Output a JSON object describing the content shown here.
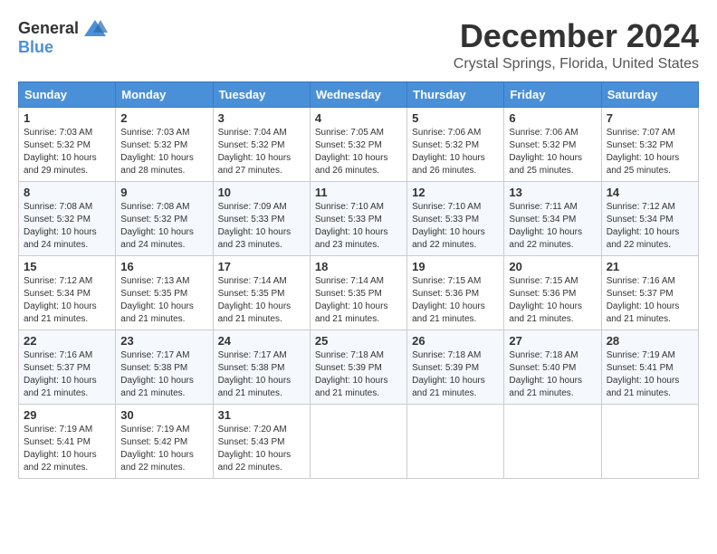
{
  "header": {
    "logo_general": "General",
    "logo_blue": "Blue",
    "month_title": "December 2024",
    "location": "Crystal Springs, Florida, United States"
  },
  "calendar": {
    "days_of_week": [
      "Sunday",
      "Monday",
      "Tuesday",
      "Wednesday",
      "Thursday",
      "Friday",
      "Saturday"
    ],
    "weeks": [
      [
        {
          "day": "1",
          "sunrise": "7:03 AM",
          "sunset": "5:32 PM",
          "daylight": "10 hours and 29 minutes."
        },
        {
          "day": "2",
          "sunrise": "7:03 AM",
          "sunset": "5:32 PM",
          "daylight": "10 hours and 28 minutes."
        },
        {
          "day": "3",
          "sunrise": "7:04 AM",
          "sunset": "5:32 PM",
          "daylight": "10 hours and 27 minutes."
        },
        {
          "day": "4",
          "sunrise": "7:05 AM",
          "sunset": "5:32 PM",
          "daylight": "10 hours and 26 minutes."
        },
        {
          "day": "5",
          "sunrise": "7:06 AM",
          "sunset": "5:32 PM",
          "daylight": "10 hours and 26 minutes."
        },
        {
          "day": "6",
          "sunrise": "7:06 AM",
          "sunset": "5:32 PM",
          "daylight": "10 hours and 25 minutes."
        },
        {
          "day": "7",
          "sunrise": "7:07 AM",
          "sunset": "5:32 PM",
          "daylight": "10 hours and 25 minutes."
        }
      ],
      [
        {
          "day": "8",
          "sunrise": "7:08 AM",
          "sunset": "5:32 PM",
          "daylight": "10 hours and 24 minutes."
        },
        {
          "day": "9",
          "sunrise": "7:08 AM",
          "sunset": "5:32 PM",
          "daylight": "10 hours and 24 minutes."
        },
        {
          "day": "10",
          "sunrise": "7:09 AM",
          "sunset": "5:33 PM",
          "daylight": "10 hours and 23 minutes."
        },
        {
          "day": "11",
          "sunrise": "7:10 AM",
          "sunset": "5:33 PM",
          "daylight": "10 hours and 23 minutes."
        },
        {
          "day": "12",
          "sunrise": "7:10 AM",
          "sunset": "5:33 PM",
          "daylight": "10 hours and 22 minutes."
        },
        {
          "day": "13",
          "sunrise": "7:11 AM",
          "sunset": "5:34 PM",
          "daylight": "10 hours and 22 minutes."
        },
        {
          "day": "14",
          "sunrise": "7:12 AM",
          "sunset": "5:34 PM",
          "daylight": "10 hours and 22 minutes."
        }
      ],
      [
        {
          "day": "15",
          "sunrise": "7:12 AM",
          "sunset": "5:34 PM",
          "daylight": "10 hours and 21 minutes."
        },
        {
          "day": "16",
          "sunrise": "7:13 AM",
          "sunset": "5:35 PM",
          "daylight": "10 hours and 21 minutes."
        },
        {
          "day": "17",
          "sunrise": "7:14 AM",
          "sunset": "5:35 PM",
          "daylight": "10 hours and 21 minutes."
        },
        {
          "day": "18",
          "sunrise": "7:14 AM",
          "sunset": "5:35 PM",
          "daylight": "10 hours and 21 minutes."
        },
        {
          "day": "19",
          "sunrise": "7:15 AM",
          "sunset": "5:36 PM",
          "daylight": "10 hours and 21 minutes."
        },
        {
          "day": "20",
          "sunrise": "7:15 AM",
          "sunset": "5:36 PM",
          "daylight": "10 hours and 21 minutes."
        },
        {
          "day": "21",
          "sunrise": "7:16 AM",
          "sunset": "5:37 PM",
          "daylight": "10 hours and 21 minutes."
        }
      ],
      [
        {
          "day": "22",
          "sunrise": "7:16 AM",
          "sunset": "5:37 PM",
          "daylight": "10 hours and 21 minutes."
        },
        {
          "day": "23",
          "sunrise": "7:17 AM",
          "sunset": "5:38 PM",
          "daylight": "10 hours and 21 minutes."
        },
        {
          "day": "24",
          "sunrise": "7:17 AM",
          "sunset": "5:38 PM",
          "daylight": "10 hours and 21 minutes."
        },
        {
          "day": "25",
          "sunrise": "7:18 AM",
          "sunset": "5:39 PM",
          "daylight": "10 hours and 21 minutes."
        },
        {
          "day": "26",
          "sunrise": "7:18 AM",
          "sunset": "5:39 PM",
          "daylight": "10 hours and 21 minutes."
        },
        {
          "day": "27",
          "sunrise": "7:18 AM",
          "sunset": "5:40 PM",
          "daylight": "10 hours and 21 minutes."
        },
        {
          "day": "28",
          "sunrise": "7:19 AM",
          "sunset": "5:41 PM",
          "daylight": "10 hours and 21 minutes."
        }
      ],
      [
        {
          "day": "29",
          "sunrise": "7:19 AM",
          "sunset": "5:41 PM",
          "daylight": "10 hours and 22 minutes."
        },
        {
          "day": "30",
          "sunrise": "7:19 AM",
          "sunset": "5:42 PM",
          "daylight": "10 hours and 22 minutes."
        },
        {
          "day": "31",
          "sunrise": "7:20 AM",
          "sunset": "5:43 PM",
          "daylight": "10 hours and 22 minutes."
        },
        null,
        null,
        null,
        null
      ]
    ]
  }
}
